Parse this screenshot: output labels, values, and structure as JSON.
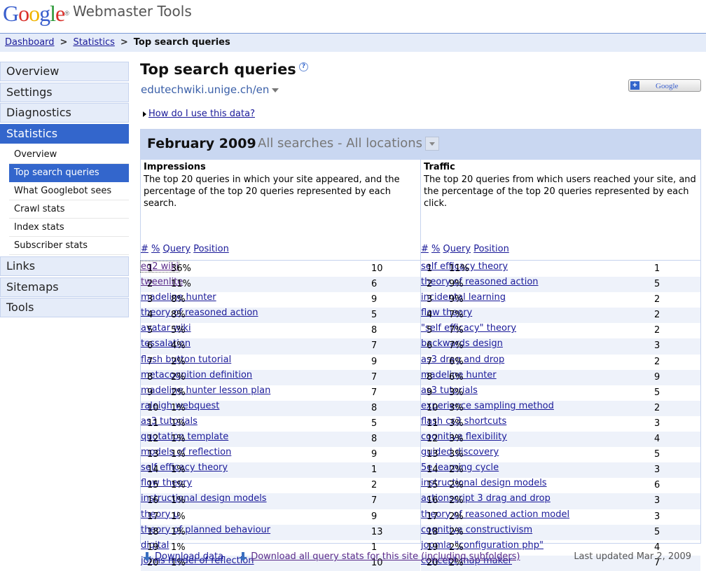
{
  "header": {
    "logo": "Google",
    "logo_tm": "®",
    "product": "Webmaster Tools"
  },
  "breadcrumb": [
    {
      "label": "Dashboard",
      "link": true
    },
    {
      "label": "Statistics",
      "link": true
    },
    {
      "label": "Top search queries",
      "link": false
    }
  ],
  "breadcrumb_sep": ">",
  "sidebar": {
    "items": [
      "Overview",
      "Settings",
      "Diagnostics",
      "Statistics"
    ],
    "active": "Statistics",
    "sub_items": [
      "Overview",
      "Top search queries",
      "What Googlebot sees",
      "Crawl stats",
      "Index stats",
      "Subscriber stats"
    ],
    "active_sub": "Top search queries",
    "items_after": [
      "Links",
      "Sitemaps",
      "Tools"
    ]
  },
  "page": {
    "title": "Top search queries",
    "help_icon": "?",
    "site": "edutechwiki.unige.ch/en",
    "add_button": "Google",
    "add_button_icon": "+",
    "howto_link": "How do I use this data?"
  },
  "panel": {
    "period": "February 2009",
    "filter": "All searches - All locations",
    "columns": {
      "num": "#",
      "pct": "%",
      "query": "Query",
      "position": "Position"
    },
    "impressions": {
      "title": "Impressions",
      "description": "The top 20 queries in which your site appeared, and the percentage of the top 20 queries represented by each search.",
      "rows": [
        [
          "1",
          "36%",
          "eq2 wiki",
          "10"
        ],
        [
          "2",
          "11%",
          "tweenlite",
          "6"
        ],
        [
          "3",
          "8%",
          "madeline hunter",
          "9"
        ],
        [
          "4",
          "8%",
          "theory of reasoned action",
          "5"
        ],
        [
          "5",
          "5%",
          "avatar wiki",
          "8"
        ],
        [
          "6",
          "4%",
          "tessalation",
          "7"
        ],
        [
          "7",
          "2%",
          "flash button tutorial",
          "9"
        ],
        [
          "8",
          "2%",
          "metacognition definition",
          "7"
        ],
        [
          "9",
          "2%",
          "madeline hunter lesson plan",
          "7"
        ],
        [
          "10",
          "1%",
          "raleigh webquest",
          "8"
        ],
        [
          "11",
          "1%",
          "as3 tutorials",
          "5"
        ],
        [
          "12",
          "1%",
          "quotation template",
          "8"
        ],
        [
          "13",
          "1%",
          "models of reflection",
          "9"
        ],
        [
          "14",
          "1%",
          "self efficacy theory",
          "1"
        ],
        [
          "15",
          "1%",
          "flow theory",
          "2"
        ],
        [
          "16",
          "1%",
          "instructional design models",
          "7"
        ],
        [
          "17",
          "1%",
          "theory u",
          "9"
        ],
        [
          "18",
          "1%",
          "theory of planned behaviour",
          "13"
        ],
        [
          "19",
          "1%",
          "digital",
          "1"
        ],
        [
          "20",
          "1%",
          "johns model of reflection",
          "10"
        ]
      ]
    },
    "traffic": {
      "title": "Traffic",
      "description": "The top 20 queries from which users reached your site, and the percentage of the top 20 queries represented by each click.",
      "rows": [
        [
          "1",
          "11%",
          "self efficacy theory",
          "1"
        ],
        [
          "2",
          "9%",
          "theory of reasoned action",
          "5"
        ],
        [
          "3",
          "9%",
          "incidental learning",
          "2"
        ],
        [
          "4",
          "7%",
          "flow theory",
          "2"
        ],
        [
          "5",
          "7%",
          "\"self efficacy\" theory",
          "2"
        ],
        [
          "6",
          "7%",
          "backwards design",
          "3"
        ],
        [
          "7",
          "6%",
          "as3 drag and drop",
          "2"
        ],
        [
          "8",
          "6%",
          "madeline hunter",
          "9"
        ],
        [
          "9",
          "3%",
          "as3 tutorials",
          "5"
        ],
        [
          "10",
          "3%",
          "experience sampling method",
          "2"
        ],
        [
          "11",
          "3%",
          "flash cs3 shortcuts",
          "3"
        ],
        [
          "12",
          "3%",
          "cognitive flexibility",
          "4"
        ],
        [
          "13",
          "3%",
          "guided discovery",
          "5"
        ],
        [
          "14",
          "2%",
          "5e learning cycle",
          "3"
        ],
        [
          "15",
          "2%",
          "instructional design models",
          "6"
        ],
        [
          "16",
          "2%",
          "actionscript 3 drag and drop",
          "3"
        ],
        [
          "17",
          "2%",
          "theory of reasoned action model",
          "3"
        ],
        [
          "18",
          "2%",
          "cognitive constructivism",
          "5"
        ],
        [
          "19",
          "2%",
          "joomla \"configuration php\"",
          "4"
        ],
        [
          "20",
          "2%",
          "concept map maker",
          "7"
        ]
      ]
    }
  },
  "footer": {
    "download": "Download data",
    "download_all": "Download all query stats for this site (including subfolders)",
    "updated": "Last updated Mar 2, 2009"
  }
}
